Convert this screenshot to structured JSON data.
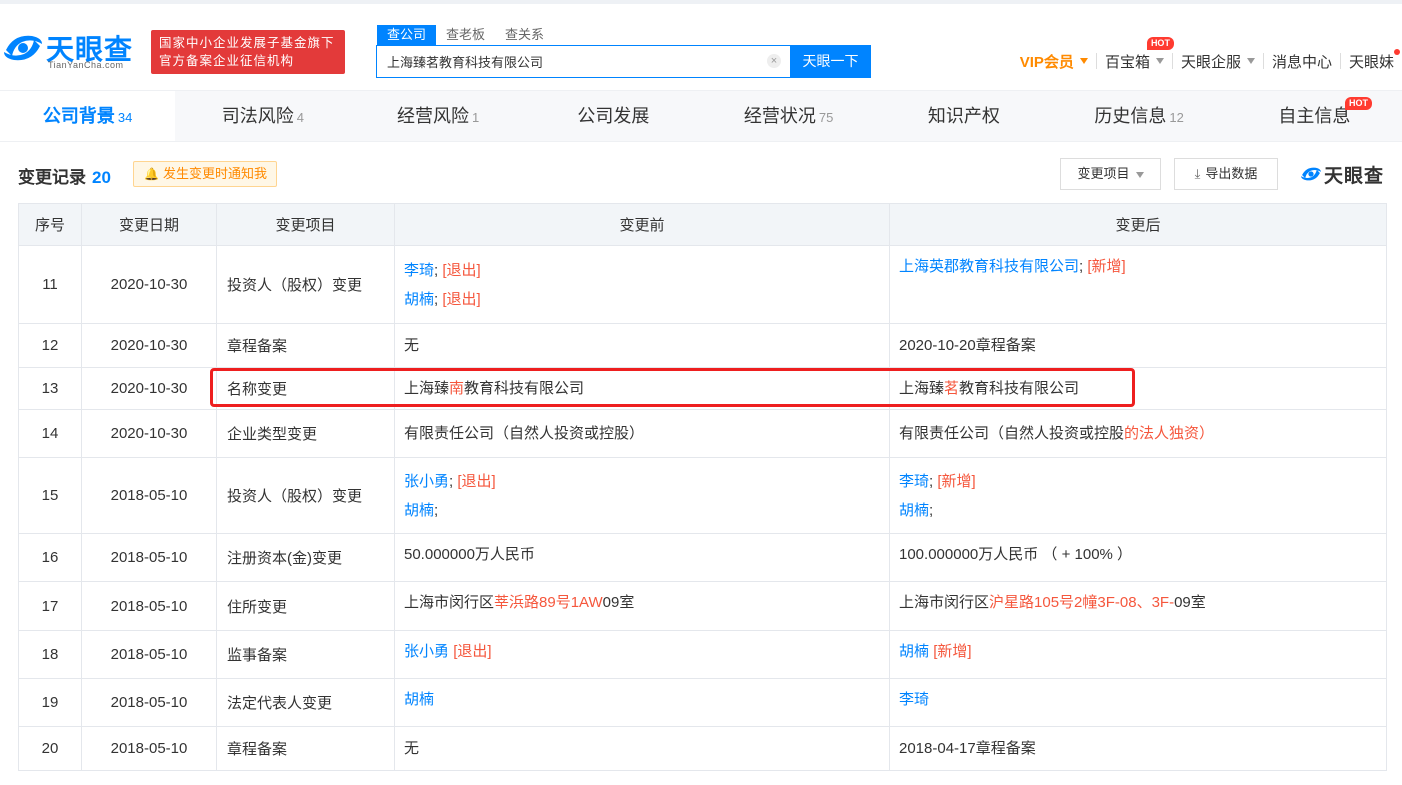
{
  "header": {
    "logo": {
      "name": "天眼查",
      "domain": "TianYanCha.com"
    },
    "banner": {
      "line1": "国家中小企业发展子基金旗下",
      "line2": "官方备案企业征信机构"
    },
    "search": {
      "tabs": [
        "查公司",
        "查老板",
        "查关系"
      ],
      "active_tab": 0,
      "value": "上海臻茗教育科技有限公司",
      "button": "天眼一下"
    },
    "nav": {
      "vip": "VIP会员",
      "treasure": "百宝箱",
      "treasure_badge": "HOT",
      "enterprise": "天眼企服",
      "messages": "消息中心",
      "user": "天眼妹"
    }
  },
  "tabs": [
    {
      "label": "公司背景",
      "count": "34",
      "active": true
    },
    {
      "label": "司法风险",
      "count": "4"
    },
    {
      "label": "经营风险",
      "count": "1"
    },
    {
      "label": "公司发展",
      "count": ""
    },
    {
      "label": "经营状况",
      "count": "75"
    },
    {
      "label": "知识产权",
      "count": ""
    },
    {
      "label": "历史信息",
      "count": "12"
    },
    {
      "label": "自主信息",
      "count": "",
      "badge": "HOT"
    }
  ],
  "section": {
    "title": "变更记录",
    "count": "20",
    "notify_label": "发生变更时通知我",
    "filter_label": "变更项目",
    "export_label": "导出数据",
    "watermark": "天眼查"
  },
  "table": {
    "headers": [
      "序号",
      "变更日期",
      "变更项目",
      "变更前",
      "变更后"
    ],
    "rows": [
      {
        "idx": "11",
        "date": "2020-10-30",
        "item": "投资人（股权）变更"
      },
      {
        "idx": "12",
        "date": "2020-10-30",
        "item": "章程备案"
      },
      {
        "idx": "13",
        "date": "2020-10-30",
        "item": "名称变更"
      },
      {
        "idx": "14",
        "date": "2020-10-30",
        "item": "企业类型变更"
      },
      {
        "idx": "15",
        "date": "2018-05-10",
        "item": "投资人（股权）变更"
      },
      {
        "idx": "16",
        "date": "2018-05-10",
        "item": "注册资本(金)变更"
      },
      {
        "idx": "17",
        "date": "2018-05-10",
        "item": "住所变更"
      },
      {
        "idx": "18",
        "date": "2018-05-10",
        "item": "监事备案"
      },
      {
        "idx": "19",
        "date": "2018-05-10",
        "item": "法定代表人变更"
      },
      {
        "idx": "20",
        "date": "2018-05-10",
        "item": "章程备案"
      }
    ],
    "cells": {
      "r11_before_1_name": "李琦",
      "r11_before_1_tag": "[退出]",
      "r11_before_2_name": "胡楠",
      "r11_before_2_tag": "[退出]",
      "r11_after_name": "上海英郡教育科技有限公司",
      "r11_after_tag": "[新增]",
      "r12_before": "无",
      "r12_after": "2020-10-20章程备案",
      "r13_before_a": "上海臻",
      "r13_before_b": "南",
      "r13_before_c": "教育科技有限公司",
      "r13_after_a": "上海臻",
      "r13_after_b": "茗",
      "r13_after_c": "教育科技有限公司",
      "r14_before": "有限责任公司（自然人投资或控股）",
      "r14_after_a": "有限责任公司（自然人投资或控股",
      "r14_after_b": "的法人独资）",
      "r15_before_1_name": "张小勇",
      "r15_before_1_tag": "[退出]",
      "r15_before_2_name": "胡楠",
      "r15_after_1_name": "李琦",
      "r15_after_1_tag": "[新增]",
      "r15_after_2_name": "胡楠",
      "r16_before": "50.000000万人民币",
      "r16_after": "100.000000万人民币 （ + 100% ）",
      "r17_before_a": "上海市闵行区",
      "r17_before_b": "莘浜路89号1AW",
      "r17_before_c": "09室",
      "r17_after_a": "上海市闵行区",
      "r17_after_b": "沪星路105号2幢3F-08、3F-",
      "r17_after_c": "09室",
      "r18_before_name": "张小勇",
      "r18_before_tag": "[退出]",
      "r18_after_name": "胡楠",
      "r18_after_tag": "[新增]",
      "r19_before": "胡楠",
      "r19_after": "李琦",
      "r20_before": "无",
      "r20_after": "2018-04-17章程备案"
    }
  }
}
